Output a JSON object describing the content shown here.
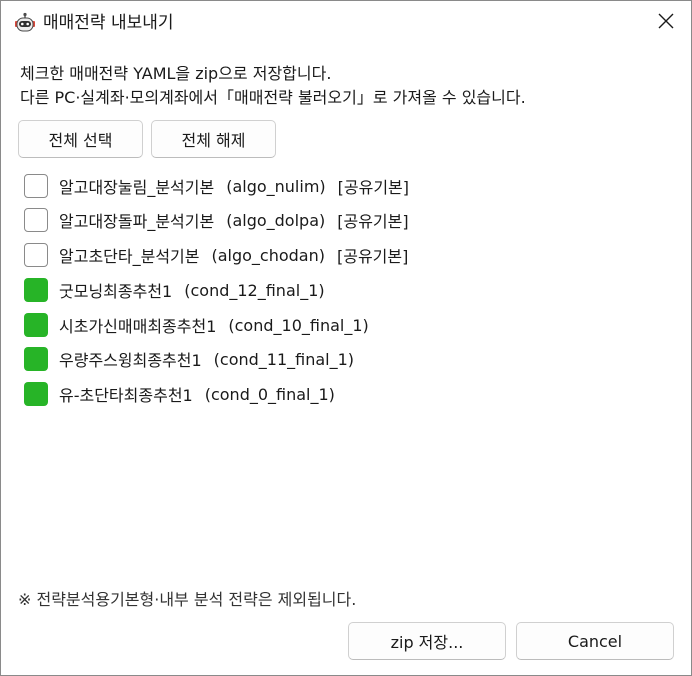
{
  "window": {
    "title": "매매전략 내보내기",
    "app_icon": "robot-icon",
    "close_icon": "close-icon"
  },
  "description": {
    "line1": "체크한 매매전략 YAML을 zip으로 저장합니다.",
    "line2": "다른 PC·실계좌·모의계좌에서「매매전략 불러오기」로 가져올 수 있습니다."
  },
  "buttons": {
    "select_all": "전체 선택",
    "deselect_all": "전체 해제",
    "save_zip": "zip 저장...",
    "cancel": "Cancel"
  },
  "strategies": [
    {
      "name": "알고대장눌림_분석기본",
      "code": "(algo_nulim)",
      "tag": "[공유기본]",
      "checked": false
    },
    {
      "name": "알고대장돌파_분석기본",
      "code": "(algo_dolpa)",
      "tag": "[공유기본]",
      "checked": false
    },
    {
      "name": "알고초단타_분석기본",
      "code": "(algo_chodan)",
      "tag": "[공유기본]",
      "checked": false
    },
    {
      "name": "굿모닝최종추천1",
      "code": "(cond_12_final_1)",
      "tag": "",
      "checked": true
    },
    {
      "name": "시초가신매매최종추천1",
      "code": "(cond_10_final_1)",
      "tag": "",
      "checked": true
    },
    {
      "name": "우량주스윙최종추천1",
      "code": "(cond_11_final_1)",
      "tag": "",
      "checked": true
    },
    {
      "name": "유-초단타최종추천1",
      "code": "(cond_0_final_1)",
      "tag": "",
      "checked": true
    }
  ],
  "footer_note": "※ 전략분석용기본형·내부 분석 전략은 제외됩니다.",
  "colors": {
    "checked": "#27b427",
    "border": "#8a8a8a"
  }
}
